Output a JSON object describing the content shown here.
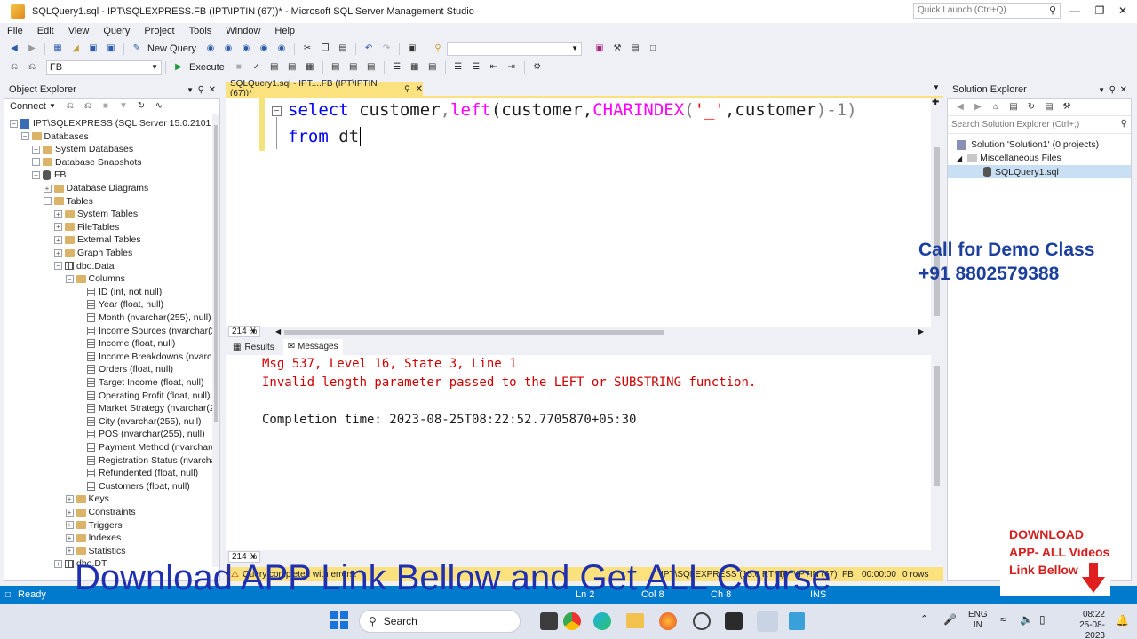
{
  "window": {
    "title": "SQLQuery1.sql - IPT\\SQLEXPRESS.FB (IPT\\IPTIN (67))* - Microsoft SQL Server Management Studio",
    "quick_launch_placeholder": "Quick Launch (Ctrl+Q)"
  },
  "menu": [
    "File",
    "Edit",
    "View",
    "Query",
    "Project",
    "Tools",
    "Window",
    "Help"
  ],
  "toolbar": {
    "new_query": "New Query",
    "database": "FB",
    "execute": "Execute"
  },
  "object_explorer": {
    "title": "Object Explorer",
    "connect": "Connect",
    "tree": [
      {
        "label": "IPT\\SQLEXPRESS (SQL Server 15.0.2101 - IPT\\",
        "level": 0,
        "exp": "-",
        "icon": "server"
      },
      {
        "label": "Databases",
        "level": 1,
        "exp": "-",
        "icon": "folder"
      },
      {
        "label": "System Databases",
        "level": 2,
        "exp": "+",
        "icon": "folder"
      },
      {
        "label": "Database Snapshots",
        "level": 2,
        "exp": "+",
        "icon": "folder"
      },
      {
        "label": "FB",
        "level": 2,
        "exp": "-",
        "icon": "db"
      },
      {
        "label": "Database Diagrams",
        "level": 3,
        "exp": "+",
        "icon": "folder"
      },
      {
        "label": "Tables",
        "level": 3,
        "exp": "-",
        "icon": "folder"
      },
      {
        "label": "System Tables",
        "level": 4,
        "exp": "+",
        "icon": "folder"
      },
      {
        "label": "FileTables",
        "level": 4,
        "exp": "+",
        "icon": "folder"
      },
      {
        "label": "External Tables",
        "level": 4,
        "exp": "+",
        "icon": "folder"
      },
      {
        "label": "Graph Tables",
        "level": 4,
        "exp": "+",
        "icon": "folder"
      },
      {
        "label": "dbo.Data",
        "level": 4,
        "exp": "-",
        "icon": "table"
      },
      {
        "label": "Columns",
        "level": 5,
        "exp": "-",
        "icon": "folder"
      },
      {
        "label": "ID (int, not null)",
        "level": 6,
        "exp": "",
        "icon": "column"
      },
      {
        "label": "Year (float, null)",
        "level": 6,
        "exp": "",
        "icon": "column"
      },
      {
        "label": "Month (nvarchar(255), null)",
        "level": 6,
        "exp": "",
        "icon": "column"
      },
      {
        "label": "Income Sources (nvarchar(2",
        "level": 6,
        "exp": "",
        "icon": "column"
      },
      {
        "label": "Income (float, null)",
        "level": 6,
        "exp": "",
        "icon": "column"
      },
      {
        "label": "Income Breakdowns (nvarch",
        "level": 6,
        "exp": "",
        "icon": "column"
      },
      {
        "label": "Orders (float, null)",
        "level": 6,
        "exp": "",
        "icon": "column"
      },
      {
        "label": "Target Income (float, null)",
        "level": 6,
        "exp": "",
        "icon": "column"
      },
      {
        "label": "Operating Profit (float, null)",
        "level": 6,
        "exp": "",
        "icon": "column"
      },
      {
        "label": "Market Strategy (nvarchar(2",
        "level": 6,
        "exp": "",
        "icon": "column"
      },
      {
        "label": "City (nvarchar(255), null)",
        "level": 6,
        "exp": "",
        "icon": "column"
      },
      {
        "label": "POS (nvarchar(255), null)",
        "level": 6,
        "exp": "",
        "icon": "column"
      },
      {
        "label": "Payment Method (nvarchar(",
        "level": 6,
        "exp": "",
        "icon": "column"
      },
      {
        "label": "Registration Status (nvarcha",
        "level": 6,
        "exp": "",
        "icon": "column"
      },
      {
        "label": "Refundented (float, null)",
        "level": 6,
        "exp": "",
        "icon": "column"
      },
      {
        "label": "Customers (float, null)",
        "level": 6,
        "exp": "",
        "icon": "column"
      },
      {
        "label": "Keys",
        "level": 5,
        "exp": "+",
        "icon": "folder"
      },
      {
        "label": "Constraints",
        "level": 5,
        "exp": "+",
        "icon": "folder"
      },
      {
        "label": "Triggers",
        "level": 5,
        "exp": "+",
        "icon": "folder"
      },
      {
        "label": "Indexes",
        "level": 5,
        "exp": "+",
        "icon": "folder"
      },
      {
        "label": "Statistics",
        "level": 5,
        "exp": "+",
        "icon": "folder"
      },
      {
        "label": "dbo.DT",
        "level": 4,
        "exp": "+",
        "icon": "table"
      }
    ]
  },
  "editor": {
    "tab_label": "SQLQuery1.sql - IPT....FB (IPT\\IPTIN (67))*",
    "line1": {
      "kw": "select",
      "a": " customer",
      "b": ",",
      "c": "left",
      "d": "(customer,",
      "e": "CHARINDEX",
      "f": "(",
      "g": "'_'",
      "h": ",customer",
      "i": ")-1)"
    },
    "line2": {
      "kw": "from",
      "rest": " dt"
    },
    "zoom": "214 %"
  },
  "results": {
    "tabs": {
      "results": "Results",
      "messages": "Messages"
    },
    "msg1": "Msg 537, Level 16, State 3, Line 1",
    "msg2": "Invalid length parameter passed to the LEFT or SUBSTRING function.",
    "completion": "Completion time: 2023-08-25T08:22:52.7705870+05:30",
    "zoom": "214 %"
  },
  "query_status": {
    "text": "Query completed with errors.",
    "server": "IPT\\SQLEXPRESS (15.0 RTM)",
    "user": "IPT\\IPTIN (67)",
    "db": "FB",
    "time": "00:00:00",
    "rows": "0 rows"
  },
  "solution_explorer": {
    "title": "Solution Explorer",
    "search_placeholder": "Search Solution Explorer (Ctrl+;)",
    "solution": "Solution 'Solution1' (0 projects)",
    "misc": "Miscellaneous Files",
    "file": "SQLQuery1.sql"
  },
  "statusbar": {
    "ready": "Ready",
    "ln": "Ln 2",
    "col": "Col 8",
    "ch": "Ch 8",
    "ins": "INS"
  },
  "taskbar": {
    "search": "Search",
    "lang1": "ENG",
    "lang2": "IN",
    "time": "08:22",
    "date": "25-08-2023"
  },
  "promo": {
    "call": "Call for Demo Class",
    "phone": "+91 8802579388",
    "banner": "Download APP Link Bellow and Get ALL Course",
    "box1": "DOWNLOAD",
    "box2": "APP- ALL Videos",
    "box3": "Link Bellow"
  },
  "colors": {
    "accent": "#007acc",
    "tab_yellow": "#fbe27f",
    "promo_red": "#d61e1e",
    "promo_blue": "#1c3f9e"
  }
}
